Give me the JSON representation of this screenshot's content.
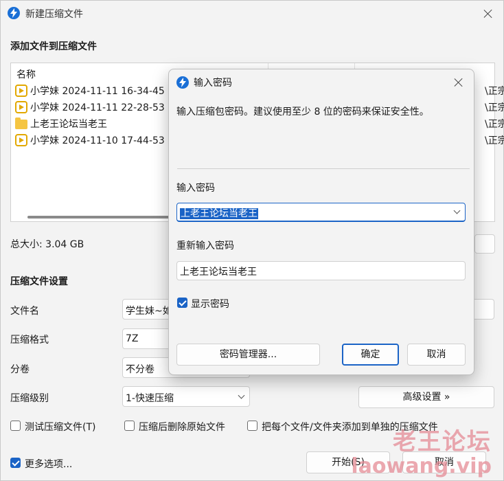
{
  "window": {
    "title": "新建压缩文件",
    "add_section_title": "添加文件到压缩文件",
    "list_header": "名称",
    "files": [
      {
        "name": "小学妹 2024-11-11 16-34-45",
        "type": "video",
        "right_text": "\\正宗"
      },
      {
        "name": "小学妹 2024-11-11 22-28-53",
        "type": "video",
        "right_text": "\\正宗"
      },
      {
        "name": "上老王论坛当老王",
        "type": "folder",
        "right_text": "\\正宗"
      },
      {
        "name": "小学妹 2024-11-10 17-44-53",
        "type": "video",
        "right_text": "\\正宗"
      }
    ],
    "total_size": "总大小: 3.04 GB",
    "settings_title": "压缩文件设置",
    "filename_label": "文件名",
    "filename_value": "学生妹~如",
    "format_label": "压缩格式",
    "format_value": "7Z",
    "split_label": "分卷",
    "split_value": "不分卷",
    "level_label": "压缩级别",
    "level_value": "1-快速压缩",
    "advanced_button": "高级设置 »",
    "test_archive": "测试压缩文件(T)",
    "delete_after": "压缩后删除原始文件",
    "each_separate": "把每个文件/文件夹添加到单独的压缩文件",
    "more_options": "更多选项...",
    "start_button": "开始(S)",
    "cancel_button": "取消"
  },
  "dialog": {
    "title": "输入密码",
    "description": "输入压缩包密码。建议使用至少 8 位的密码来保证安全性。",
    "password_label": "输入密码",
    "password_value": "上老王论坛当老王",
    "reenter_label": "重新输入密码",
    "reenter_value": "上老王论坛当老王",
    "show_password": "显示密码",
    "show_password_checked": true,
    "manager_button": "密码管理器...",
    "ok_button": "确定",
    "cancel_button": "取消"
  },
  "watermark": {
    "text": "老王论坛",
    "url": "laowang.vip"
  },
  "colors": {
    "accent": "#1a63c6",
    "video_icon": "#e2a800",
    "folder_icon": "#f5c542",
    "watermark": "#e58c96"
  }
}
